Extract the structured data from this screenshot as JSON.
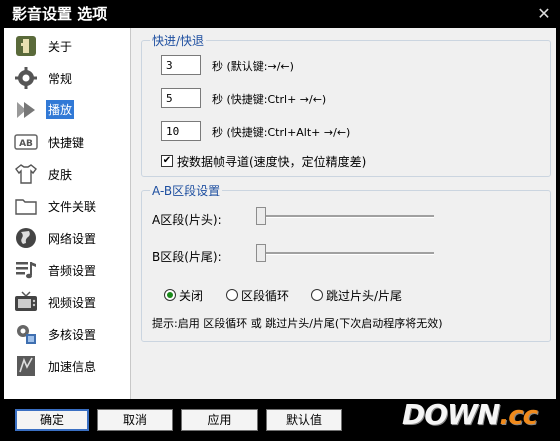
{
  "window": {
    "title": "影音设置 选项",
    "close_glyph": "✕"
  },
  "sidebar": {
    "items": [
      {
        "label": "关于",
        "icon": "info-icon",
        "active": false
      },
      {
        "label": "常规",
        "icon": "gear-icon",
        "active": false
      },
      {
        "label": "播放",
        "icon": "play-icon",
        "active": true
      },
      {
        "label": "快捷键",
        "icon": "keyboard-icon",
        "active": false
      },
      {
        "label": "皮肤",
        "icon": "shirt-icon",
        "active": false
      },
      {
        "label": "文件关联",
        "icon": "folder-icon",
        "active": false
      },
      {
        "label": "网络设置",
        "icon": "globe-icon",
        "active": false
      },
      {
        "label": "音频设置",
        "icon": "audio-icon",
        "active": false
      },
      {
        "label": "视频设置",
        "icon": "tv-icon",
        "active": false
      },
      {
        "label": "多核设置",
        "icon": "cores-icon",
        "active": false
      },
      {
        "label": "加速信息",
        "icon": "accel-icon",
        "active": false
      }
    ]
  },
  "seek": {
    "title": "快进/快退",
    "rows": [
      {
        "value": "3",
        "label": "秒 (默认键:→/←)"
      },
      {
        "value": "5",
        "label": "秒 (快捷键:Ctrl+ →/←)"
      },
      {
        "value": "10",
        "label": "秒 (快捷键:Ctrl+Alt+ →/←)"
      }
    ],
    "keyframe_checkbox": {
      "label": "按数据帧寻道(速度快，定位精度差)",
      "checked": true
    }
  },
  "ab": {
    "title": "A-B区段设置",
    "a_label": "A区段(片头):",
    "b_label": "B区段(片尾):",
    "a_value": 0,
    "b_value": 0,
    "radios": [
      {
        "label": "关闭",
        "checked": true
      },
      {
        "label": "区段循环",
        "checked": false
      },
      {
        "label": "跳过片头/片尾",
        "checked": false
      }
    ],
    "hint": "提示:启用 区段循环 或 跳过片头/片尾(下次启动程序将无效)"
  },
  "buttons": {
    "ok": "确定",
    "cancel": "取消",
    "apply": "应用",
    "default": "默认值"
  },
  "watermark": {
    "main": "DOWN",
    "suffix": ".cc"
  },
  "colors": {
    "accent": "#3179d6",
    "group_title": "#1e4fa0",
    "radio_dot": "#1a8a1a",
    "watermark_accent": "#f08a1c"
  }
}
